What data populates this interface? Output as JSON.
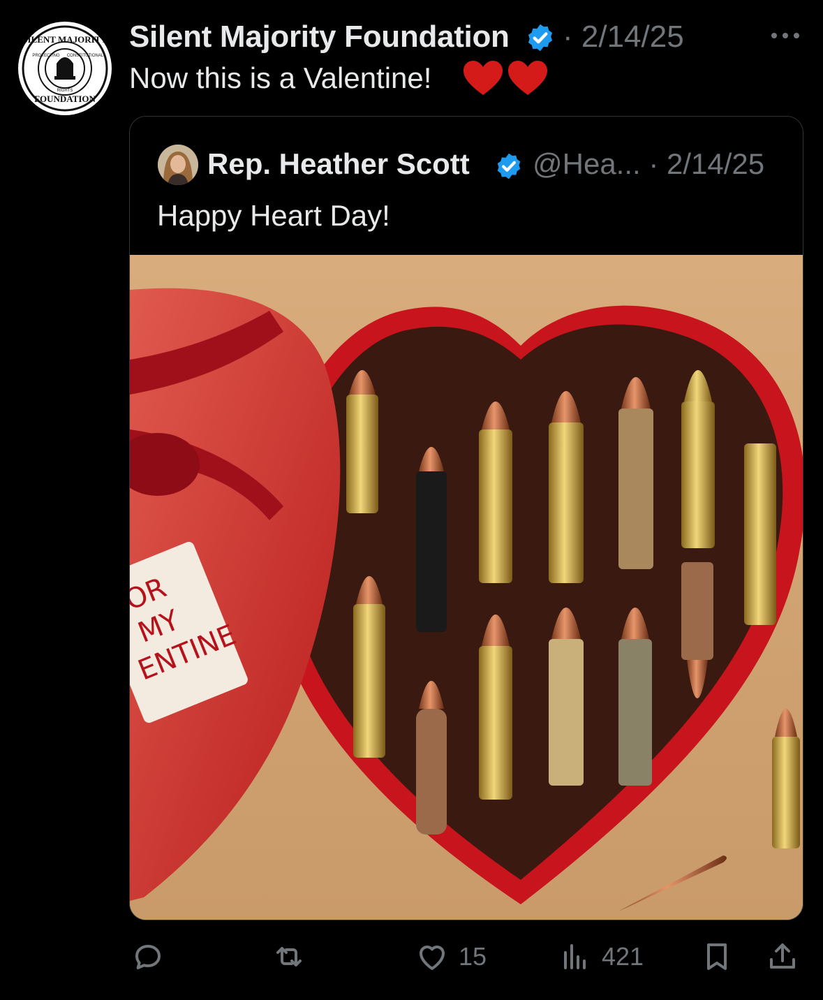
{
  "post": {
    "author_name": "Silent Majority Foundation",
    "separator_date": "· 2/14/25",
    "text": "Now this is a Valentine!",
    "emoji": "❤️❤️",
    "avatar_logo": {
      "top": "SILENT MAJORITY",
      "bottom": "FOUNDATION",
      "inner_left": "PROTECTING",
      "inner_right": "CONSTITUTIONAL",
      "inner_bottom": "RIGHTS"
    }
  },
  "quoted": {
    "author_name": "Rep. Heather Scott",
    "handle_date": "@Hea... · 2/14/25",
    "text": "Happy Heart Day!",
    "image_tag_text": [
      "OR",
      "MY",
      "ENTINE"
    ]
  },
  "actions": {
    "reply_icon": "reply-icon",
    "repost_icon": "repost-icon",
    "like_count": "15",
    "views_count": "421"
  },
  "colors": {
    "background": "#000000",
    "text": "#e7e9ea",
    "muted": "#71767b",
    "verified": "#1d9bf0",
    "heart": "#e0245e"
  }
}
